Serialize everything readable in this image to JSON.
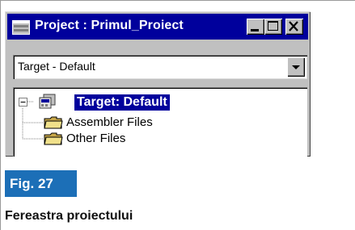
{
  "window": {
    "title": "Project : Primul_Proiect",
    "icon": "project-window-icon",
    "buttons": [
      "minimize-icon",
      "maximize-icon",
      "close-icon"
    ]
  },
  "target_select": {
    "selected": "Target - Default",
    "icon": "dropdown-arrow-icon"
  },
  "tree": {
    "root": {
      "label": "Target: Default",
      "expander": "minus",
      "icon": "target-icon"
    },
    "children": [
      {
        "label": "Assembler Files",
        "icon": "folder-icon"
      },
      {
        "label": "Other Files",
        "icon": "folder-icon"
      }
    ]
  },
  "figure": {
    "number": "Fig. 27",
    "caption": "Fereastra proiectului"
  },
  "colors": {
    "titlebar": "#00009c",
    "selection": "#00009c",
    "figure_badge": "#1c6fb7",
    "window_face": "#c0c0c0"
  }
}
